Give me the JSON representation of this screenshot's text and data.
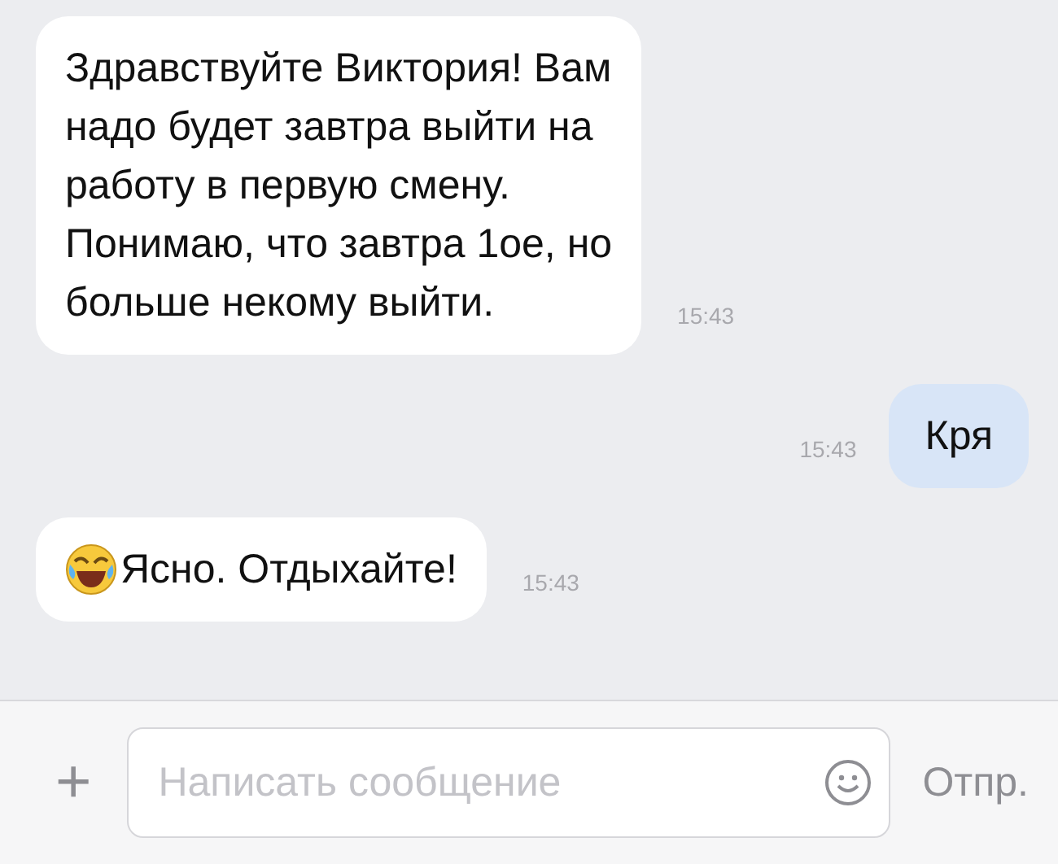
{
  "messages": [
    {
      "kind": "incoming",
      "text": "Здравствуйте Виктория! Вам\nнадо будет завтра выйти на\nработу в первую смену.\nПонимаю, что завтра 1ое, но\nбольше некому выйти.",
      "time": "15:43",
      "emoji": false
    },
    {
      "kind": "outgoing",
      "text": "Кря",
      "time": "15:43",
      "emoji": false
    },
    {
      "kind": "incoming",
      "text": "Ясно. Отдыхайте!",
      "time": "15:43",
      "emoji": true
    }
  ],
  "composer": {
    "add": "+",
    "placeholder": "Написать сообщение",
    "send": "Отпр."
  }
}
